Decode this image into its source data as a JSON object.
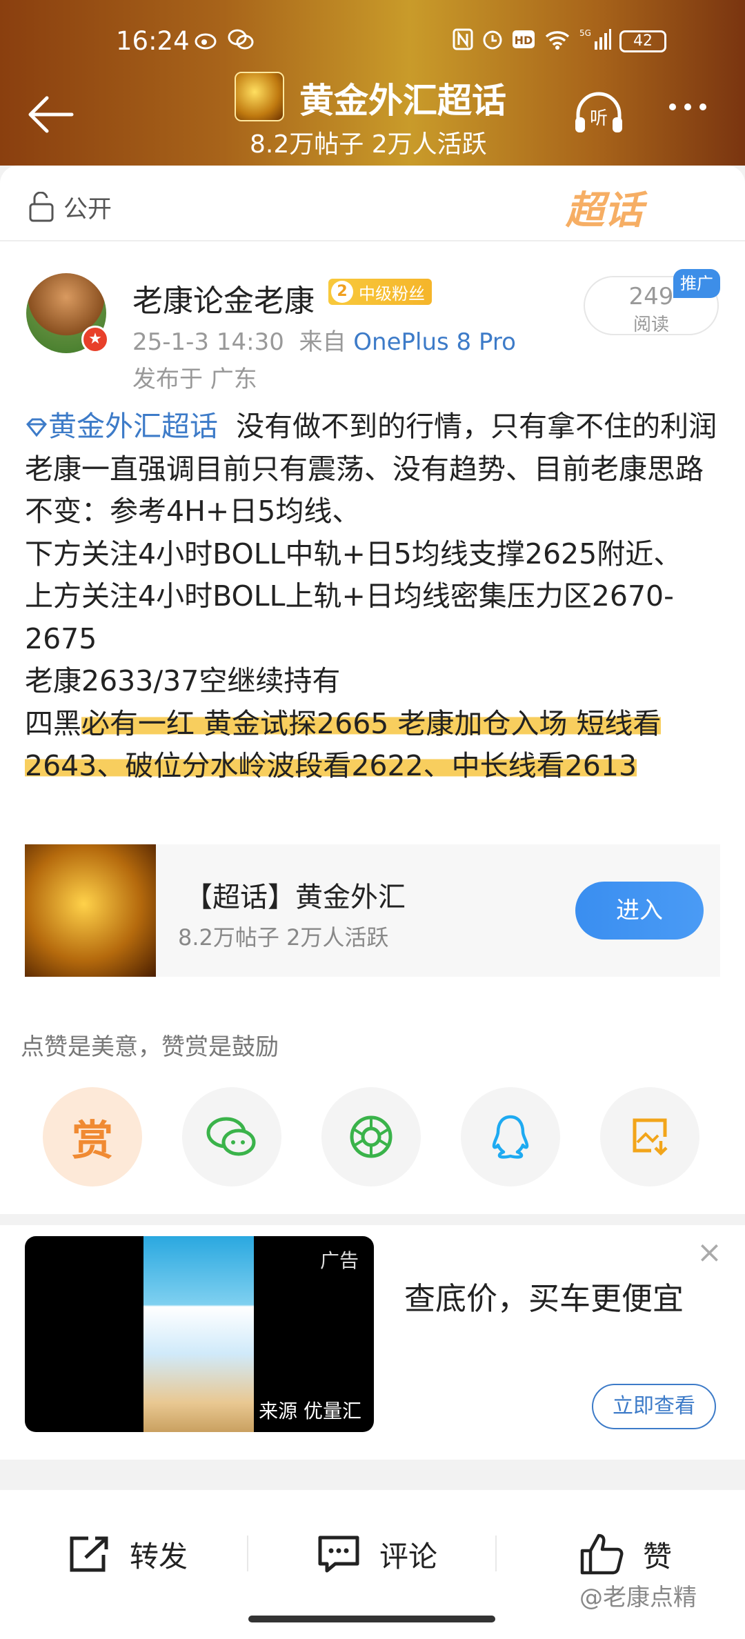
{
  "status_bar": {
    "time": "16:24",
    "battery": "42",
    "network": "5G"
  },
  "header": {
    "title": "黄金外汇超话",
    "subtitle": "8.2万帖子 2万人活跃"
  },
  "post_card": {
    "visibility": "公开",
    "chaohua_deco": "超话",
    "author": {
      "name": "老康论金老康",
      "fan_level": "2",
      "fan_badge": "中级粉丝",
      "time": "25-1-3 14:30",
      "from_label": "来自",
      "device": "OnePlus 8 Pro",
      "location": "发布于 广东"
    },
    "reads": {
      "count": "249",
      "label": "阅读",
      "promo": "推广"
    },
    "content": {
      "topic": "黄金外汇超话",
      "line1": "没有做不到的行情，只有拿不住的利润",
      "line2": "老康一直强调目前只有震荡、没有趋势、目前老康思路不变：参考4H+日5均线、",
      "line3": "下方关注4小时BOLL中轨+日5均线支撑2625附近、",
      "line4": "上方关注4小时BOLL上轨+日均线密集压力区2670-2675",
      "line5": "老康2633/37空继续持有",
      "line6_a": "四黑",
      "line6_b": "必有一红 黄金试探2665 老康加仓入场 短线看2643、破位分水岭波段看2622、中长线看2613"
    },
    "topic_card": {
      "title": "【超话】黄金外汇",
      "subtitle": "8.2万帖子 2万人活跃",
      "button": "进入"
    },
    "praise_text": "点赞是美意，赞赏是鼓励",
    "reward_label": "赏"
  },
  "ad": {
    "tag": "广告",
    "source": "来源 优量汇",
    "title": "查底价，买车更便宜",
    "button": "立即查看",
    "close": "×"
  },
  "bottom_bar": {
    "forward": "转发",
    "comment": "评论",
    "like": "赞",
    "watermark": "@老康点精"
  },
  "colors": {
    "link_blue": "#3d7bc8",
    "accent_orange": "#f08a32",
    "highlight": "#f5be28"
  }
}
